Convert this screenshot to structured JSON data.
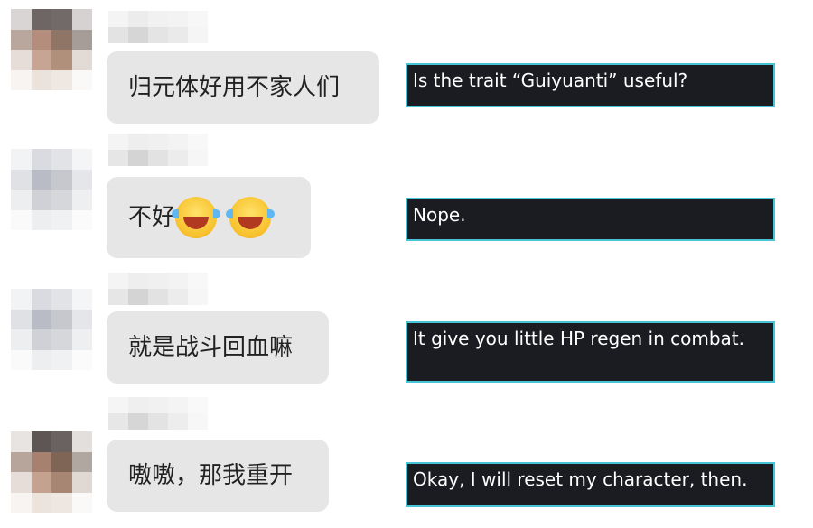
{
  "messages": [
    {
      "text": "归元体好用不家人们",
      "emojis": [],
      "translation": "Is the trait “Guiyuanti” useful?"
    },
    {
      "text": "不好",
      "emojis": [
        "face-with-tears-of-joy",
        "face-with-tears-of-joy"
      ],
      "translation": "Nope."
    },
    {
      "text": "就是战斗回血嘛",
      "emojis": [],
      "translation": "It give you little HP regen in combat."
    },
    {
      "text": "嗷嗷，那我重开",
      "emojis": [],
      "translation": "Okay, I will reset my character, then."
    }
  ],
  "colors": {
    "bubble": "#e6e6e6",
    "caption_bg": "#1b1c21",
    "caption_border": "#47c4d6",
    "caption_text": "#ffffff"
  }
}
